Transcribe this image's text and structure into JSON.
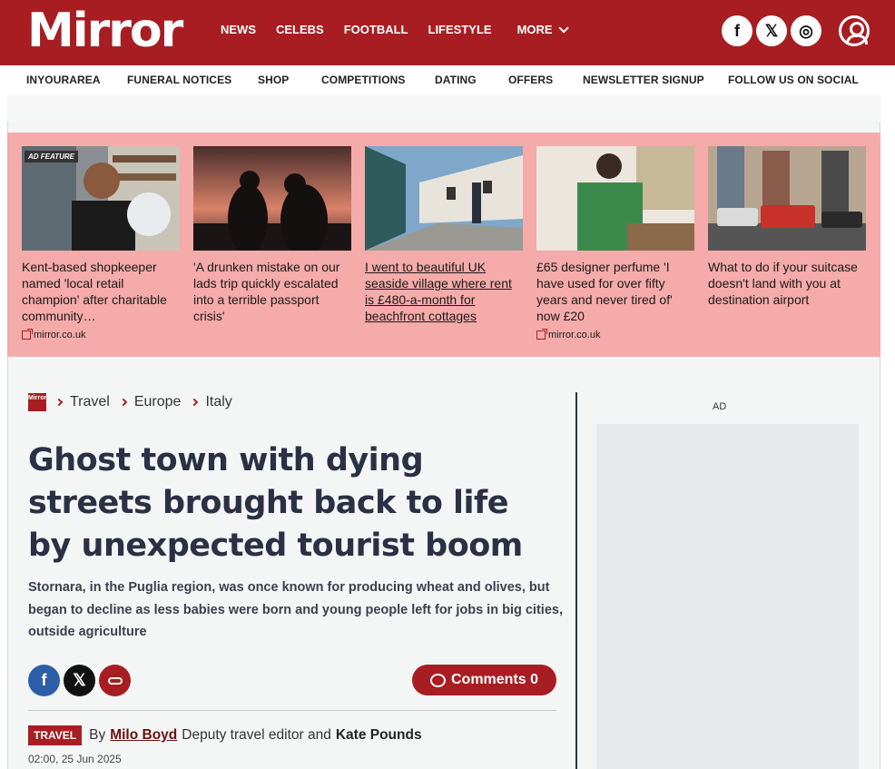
{
  "header": {
    "logo": "Mirror",
    "nav": [
      "NEWS",
      "CELEBS",
      "FOOTBALL",
      "LIFESTYLE",
      "MORE"
    ],
    "social": [
      {
        "icon": "facebook-icon",
        "glyph": "f"
      },
      {
        "icon": "x-icon",
        "glyph": "𝕏"
      },
      {
        "icon": "instagram-icon",
        "glyph": "◎"
      }
    ]
  },
  "subnav": [
    "INYOURAREA",
    "FUNERAL NOTICES",
    "SHOP",
    "COMPETITIONS",
    "DATING",
    "OFFERS",
    "NEWSLETTER SIGNUP",
    "FOLLOW US ON SOCIAL"
  ],
  "promo": {
    "ad_badge": "AD FEATURE",
    "cards": [
      {
        "title": "Kent-based shopkeeper named 'local retail champion' after charitable community…",
        "source": "mirror.co.uk"
      },
      {
        "title": "'A drunken mistake on our lads trip quickly escalated into a terrible passport crisis'",
        "source": ""
      },
      {
        "title": "I went to beautiful UK seaside village where rent is £480-a-month for beachfront cottages",
        "source": ""
      },
      {
        "title": "£65 designer perfume 'I have used for over fifty years and never tired of' now £20",
        "source": "mirror.co.uk"
      },
      {
        "title": "What to do if your suitcase doesn't land with you at destination airport",
        "source": ""
      }
    ]
  },
  "article": {
    "breadcrumb_logo": "Mirror",
    "breadcrumbs": [
      "Travel",
      "Europe",
      "Italy"
    ],
    "headline": "Ghost town with dying streets brought back to life by unexpected tourist boom",
    "standfirst": "Stornara, in the Puglia region, was once known for producing wheat and olives, but began to decline as less babies were born and young people left for jobs in big cities, outside agriculture",
    "share_icons": [
      "facebook-icon",
      "x-icon",
      "link-icon"
    ],
    "comments_label": "Comments 0",
    "category": "TRAVEL",
    "by": "By",
    "author": "Milo Boyd",
    "author_role": "Deputy travel editor and",
    "coauthor": "Kate Pounds",
    "date": "02:00, 25 Jun 2025"
  },
  "sidebar": {
    "ad_label": "AD"
  },
  "colors": {
    "brand": "#a81d22",
    "promo_bg": "#f4aba9",
    "page_bg": "#f4f6f6"
  }
}
